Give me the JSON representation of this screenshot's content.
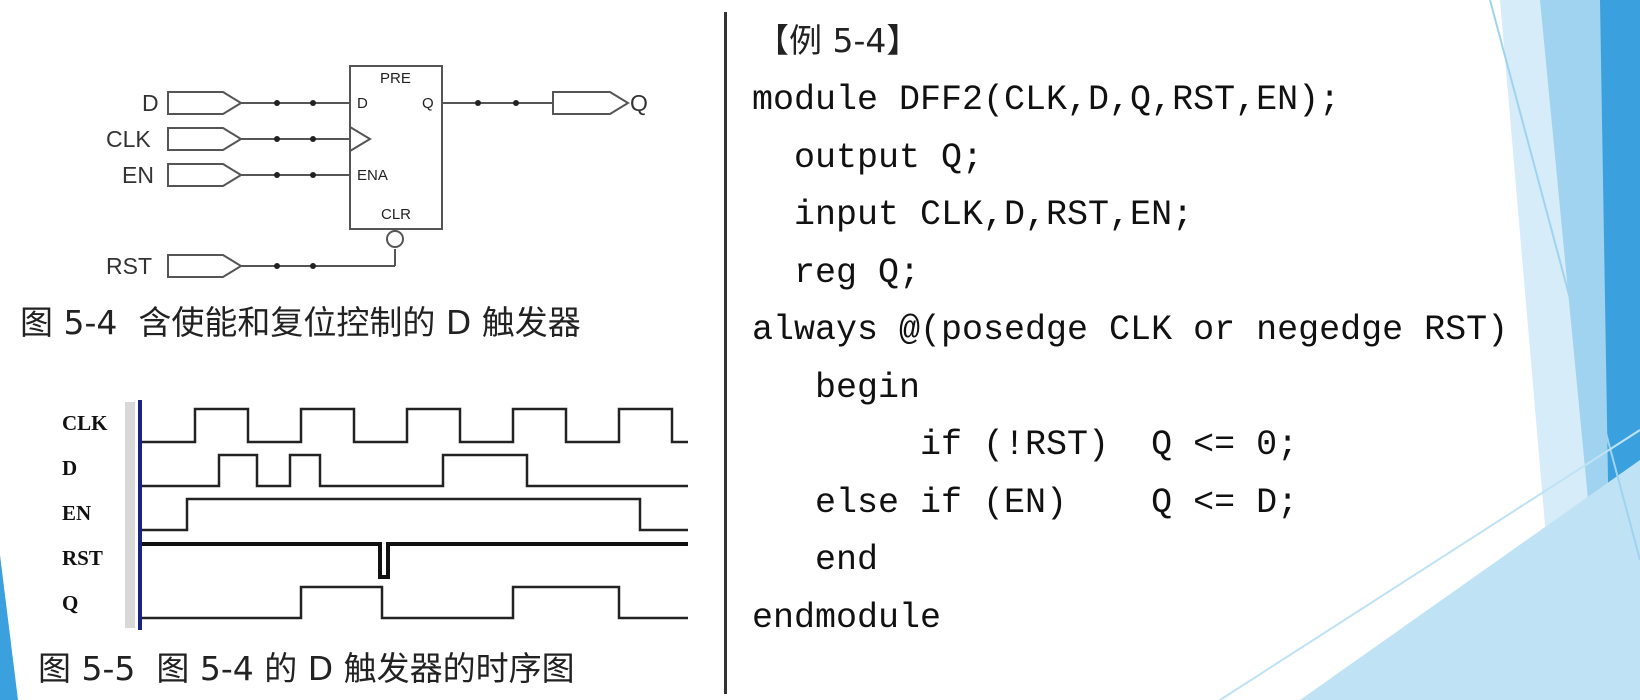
{
  "schematic": {
    "inputs": {
      "d": "D",
      "clk": "CLK",
      "en": "EN",
      "rst": "RST"
    },
    "output": "Q",
    "flipflop": {
      "pre": "PRE",
      "d": "D",
      "q": "Q",
      "ena": "ENA",
      "clr": "CLR"
    }
  },
  "figure_5_4_caption": "图 5-4  含使能和复位控制的 D 触发器",
  "timing": {
    "signals": [
      "CLK",
      "D",
      "EN",
      "RST",
      "Q"
    ]
  },
  "figure_5_5_caption": "图 5-5  图 5-4 的 D 触发器的时序图",
  "code": {
    "example_title": "【例 5-4】",
    "lines": [
      "module DFF2(CLK,D,Q,RST,EN);",
      "  output Q;",
      "  input CLK,D,RST,EN;",
      "  reg Q;",
      "always @(posedge CLK or negedge RST)",
      "   begin",
      "        if (!RST)  Q <= 0;",
      "   else if (EN)    Q <= D;",
      "   end",
      "endmodule"
    ]
  },
  "colors": {
    "accent": "#3aa1de",
    "accent_light": "#9fd3f0",
    "divider": "#333333",
    "timing_axis": "#1a237e"
  }
}
